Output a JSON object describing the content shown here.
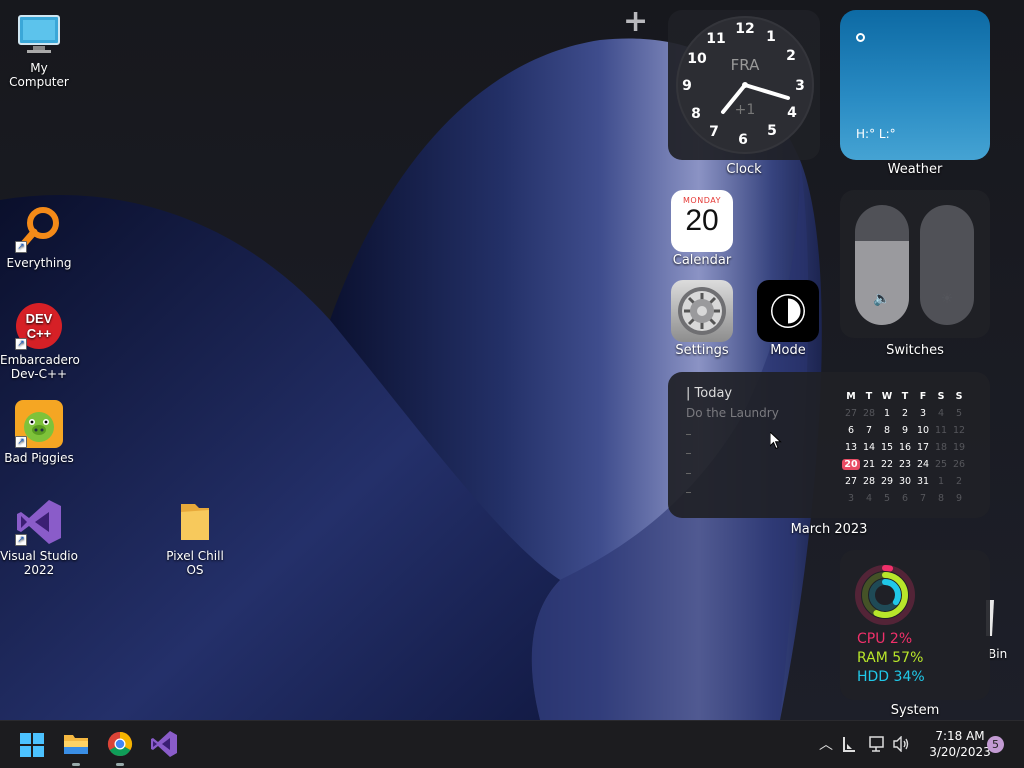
{
  "desktop": {
    "icons": [
      {
        "label": "My Computer",
        "icon": "computer-icon"
      },
      {
        "label": "Everything",
        "icon": "search-icon"
      },
      {
        "label": "Embarcadero Dev-C++",
        "icon": "devcpp-icon",
        "badge": "DEV C++"
      },
      {
        "label": "Bad Piggies",
        "icon": "pig-icon"
      },
      {
        "label": "Visual Studio 2022",
        "icon": "visual-studio-icon"
      },
      {
        "label": "Pixel Chill OS",
        "icon": "folder-icon"
      },
      {
        "label": "Bin",
        "icon": "recycle-bin-icon"
      }
    ]
  },
  "widgets": {
    "add_symbol": "+",
    "clock": {
      "label": "Clock",
      "city": "FRA",
      "offset": "+1",
      "numbers": [
        "12",
        "1",
        "2",
        "3",
        "4",
        "5",
        "6",
        "7",
        "8",
        "9",
        "10",
        "11"
      ],
      "time": "7:18"
    },
    "weather": {
      "label": "Weather",
      "high_low": "H:° L:°"
    },
    "calendar": {
      "label": "Calendar",
      "weekday": "MONDAY",
      "day": "20"
    },
    "settings": {
      "label": "Settings"
    },
    "mode": {
      "label": "Mode"
    },
    "switches": {
      "label": "Switches",
      "volume_level": 0.7,
      "brightness_level": 0.0
    },
    "month_calendar": {
      "label": "March 2023",
      "today_title": "| Today",
      "task": "Do the Laundry",
      "weekdays": [
        "M",
        "T",
        "W",
        "T",
        "F",
        "S",
        "S"
      ],
      "weeks": [
        [
          "27",
          "28",
          "1",
          "2",
          "3",
          "4",
          "5"
        ],
        [
          "6",
          "7",
          "8",
          "9",
          "10",
          "11",
          "12"
        ],
        [
          "13",
          "14",
          "15",
          "16",
          "17",
          "18",
          "19"
        ],
        [
          "20",
          "21",
          "22",
          "23",
          "24",
          "25",
          "26"
        ],
        [
          "27",
          "28",
          "29",
          "30",
          "31",
          "1",
          "2"
        ],
        [
          "3",
          "4",
          "5",
          "6",
          "7",
          "8",
          "9"
        ]
      ],
      "today": "20"
    },
    "system": {
      "label": "System",
      "cpu": "CPU 2%",
      "ram": "RAM 57%",
      "hdd": "HDD 34%",
      "cpu_value": 0.02,
      "ram_value": 0.57,
      "hdd_value": 0.34,
      "colors": {
        "cpu": "#f0306a",
        "ram": "#b8e62a",
        "hdd": "#20c8e8"
      }
    }
  },
  "taskbar": {
    "apps": [
      {
        "name": "Start",
        "icon": "windows-start-icon"
      },
      {
        "name": "File Explorer",
        "icon": "file-explorer-icon"
      },
      {
        "name": "Google Chrome",
        "icon": "chrome-icon"
      },
      {
        "name": "Visual Studio",
        "icon": "visual-studio-icon"
      }
    ],
    "tray": {
      "time": "7:18 AM",
      "date": "3/20/2023",
      "notifications": "5"
    }
  }
}
